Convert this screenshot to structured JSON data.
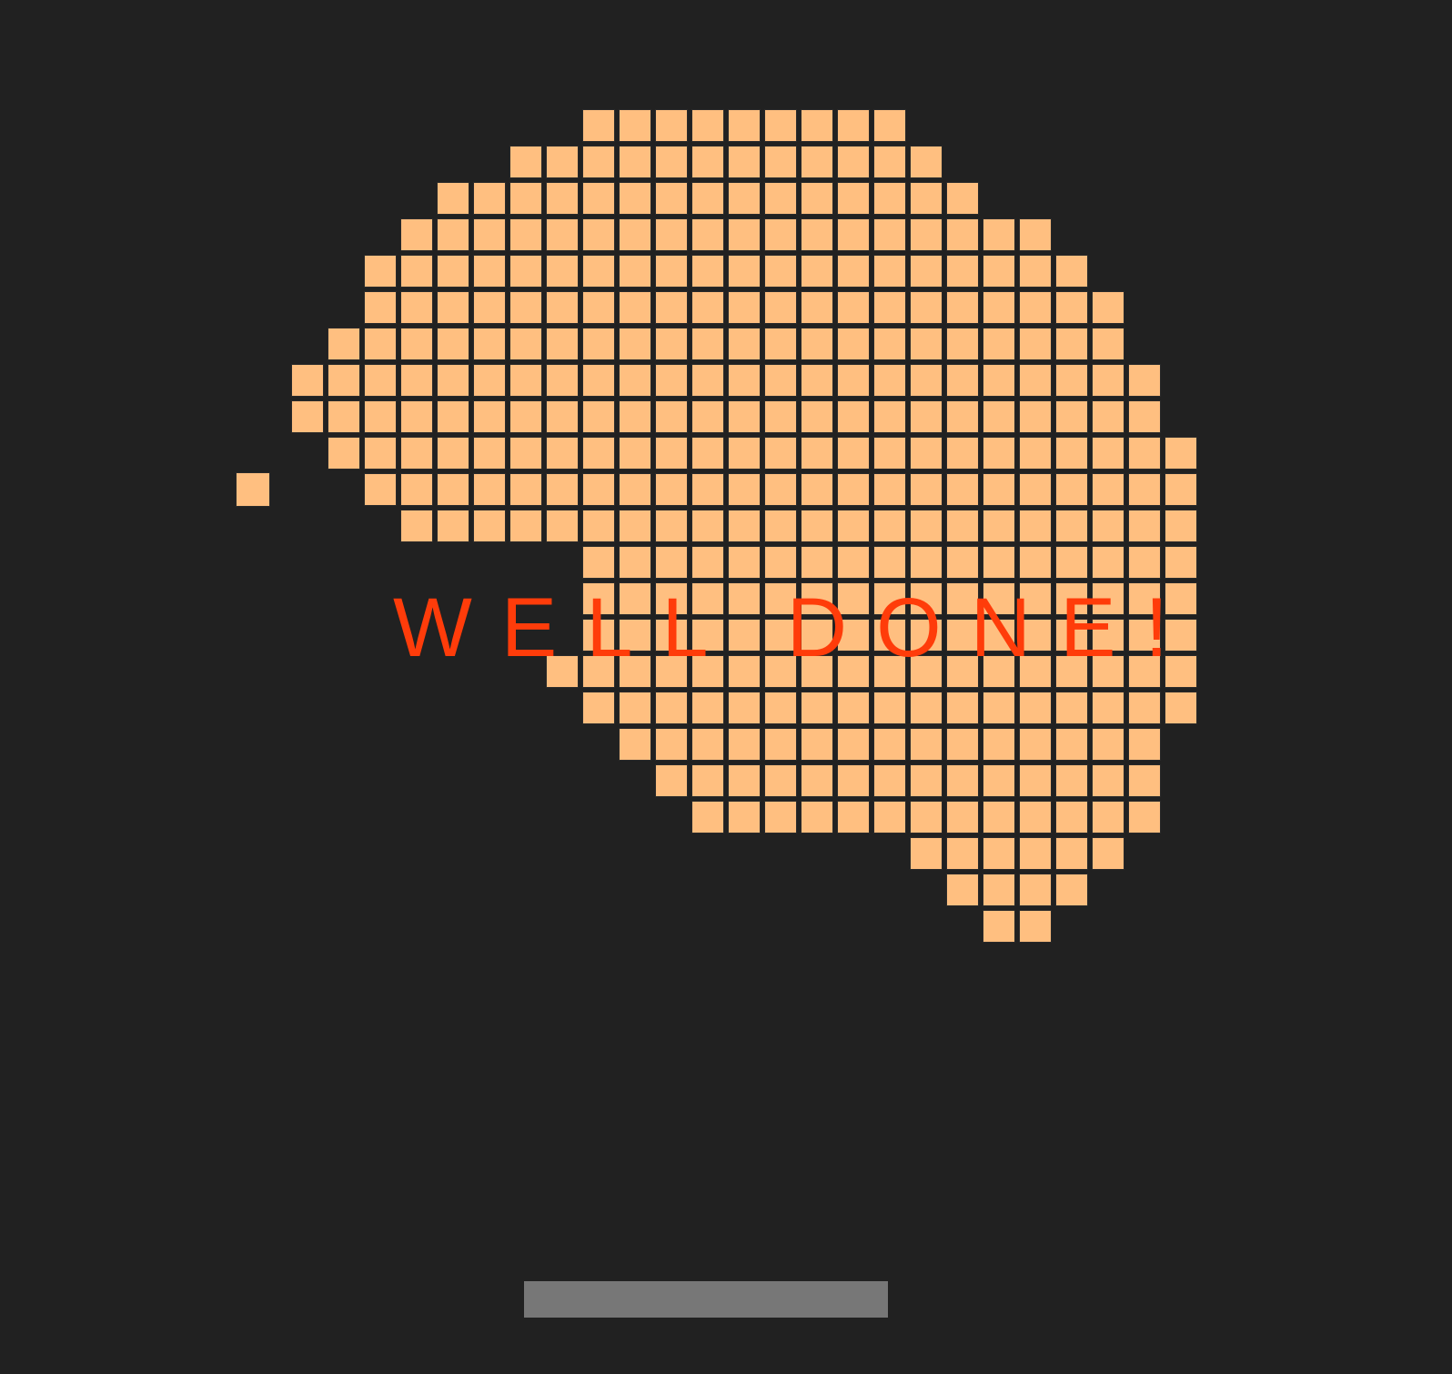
{
  "game": {
    "message": "WELL DONE!",
    "colors": {
      "background": "#212121",
      "brick": "#ffbf80",
      "brick_border": "#2a2a2a",
      "message": "#ff3c0a",
      "paddle": "#777777"
    },
    "bricks": {
      "rows": [
        [
          8,
          16
        ],
        [
          6,
          17
        ],
        [
          4,
          18
        ],
        [
          3,
          20
        ],
        [
          2,
          21
        ],
        [
          2,
          22
        ],
        [
          1,
          22
        ],
        [
          0,
          23
        ],
        [
          0,
          23
        ],
        [
          1,
          24
        ],
        [
          2,
          24
        ],
        [
          3,
          24
        ],
        [
          8,
          24
        ],
        [
          8,
          24
        ],
        [
          8,
          24
        ],
        [
          7,
          24
        ],
        [
          8,
          24
        ],
        [
          9,
          23
        ],
        [
          10,
          23
        ],
        [
          11,
          23
        ],
        [
          17,
          22
        ],
        [
          18,
          21
        ],
        [
          19,
          20
        ]
      ],
      "stray_count": 1
    }
  }
}
